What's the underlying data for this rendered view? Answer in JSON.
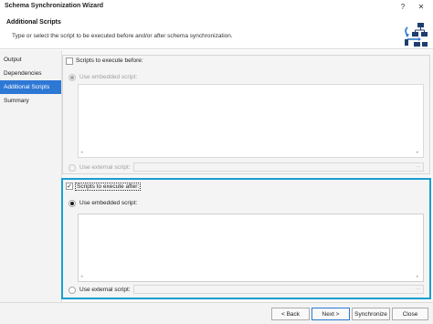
{
  "window": {
    "title": "Schema Synchronization Wizard",
    "help_glyph": "?",
    "close_glyph": "✕"
  },
  "header": {
    "title": "Additional Scripts",
    "description": "Type or select the script to be executed before and/or after schema synchronization."
  },
  "sidebar": {
    "items": [
      {
        "label": "Output",
        "active": false
      },
      {
        "label": "Dependencies",
        "active": false
      },
      {
        "label": "Additional Scripts",
        "active": true
      },
      {
        "label": "Summary",
        "active": false
      }
    ]
  },
  "before_scripts": {
    "checkbox_label": "Scripts to execute before:",
    "checked": false,
    "embedded_label": "Use embedded script:",
    "external_label": "Use external script:",
    "browse_glyph": "..."
  },
  "after_scripts": {
    "checkbox_label": "Scripts to execute after:",
    "checked": true,
    "check_glyph": "✓",
    "embedded_label": "Use embedded script:",
    "external_label": "Use external script:",
    "browse_glyph": "..."
  },
  "footer": {
    "back_label": "< Back",
    "next_label": "Next >",
    "synchronize_label": "Synchronize",
    "close_label": "Close"
  },
  "colors": {
    "accent": "#2d78d4",
    "highlight_border": "#199fd1"
  }
}
